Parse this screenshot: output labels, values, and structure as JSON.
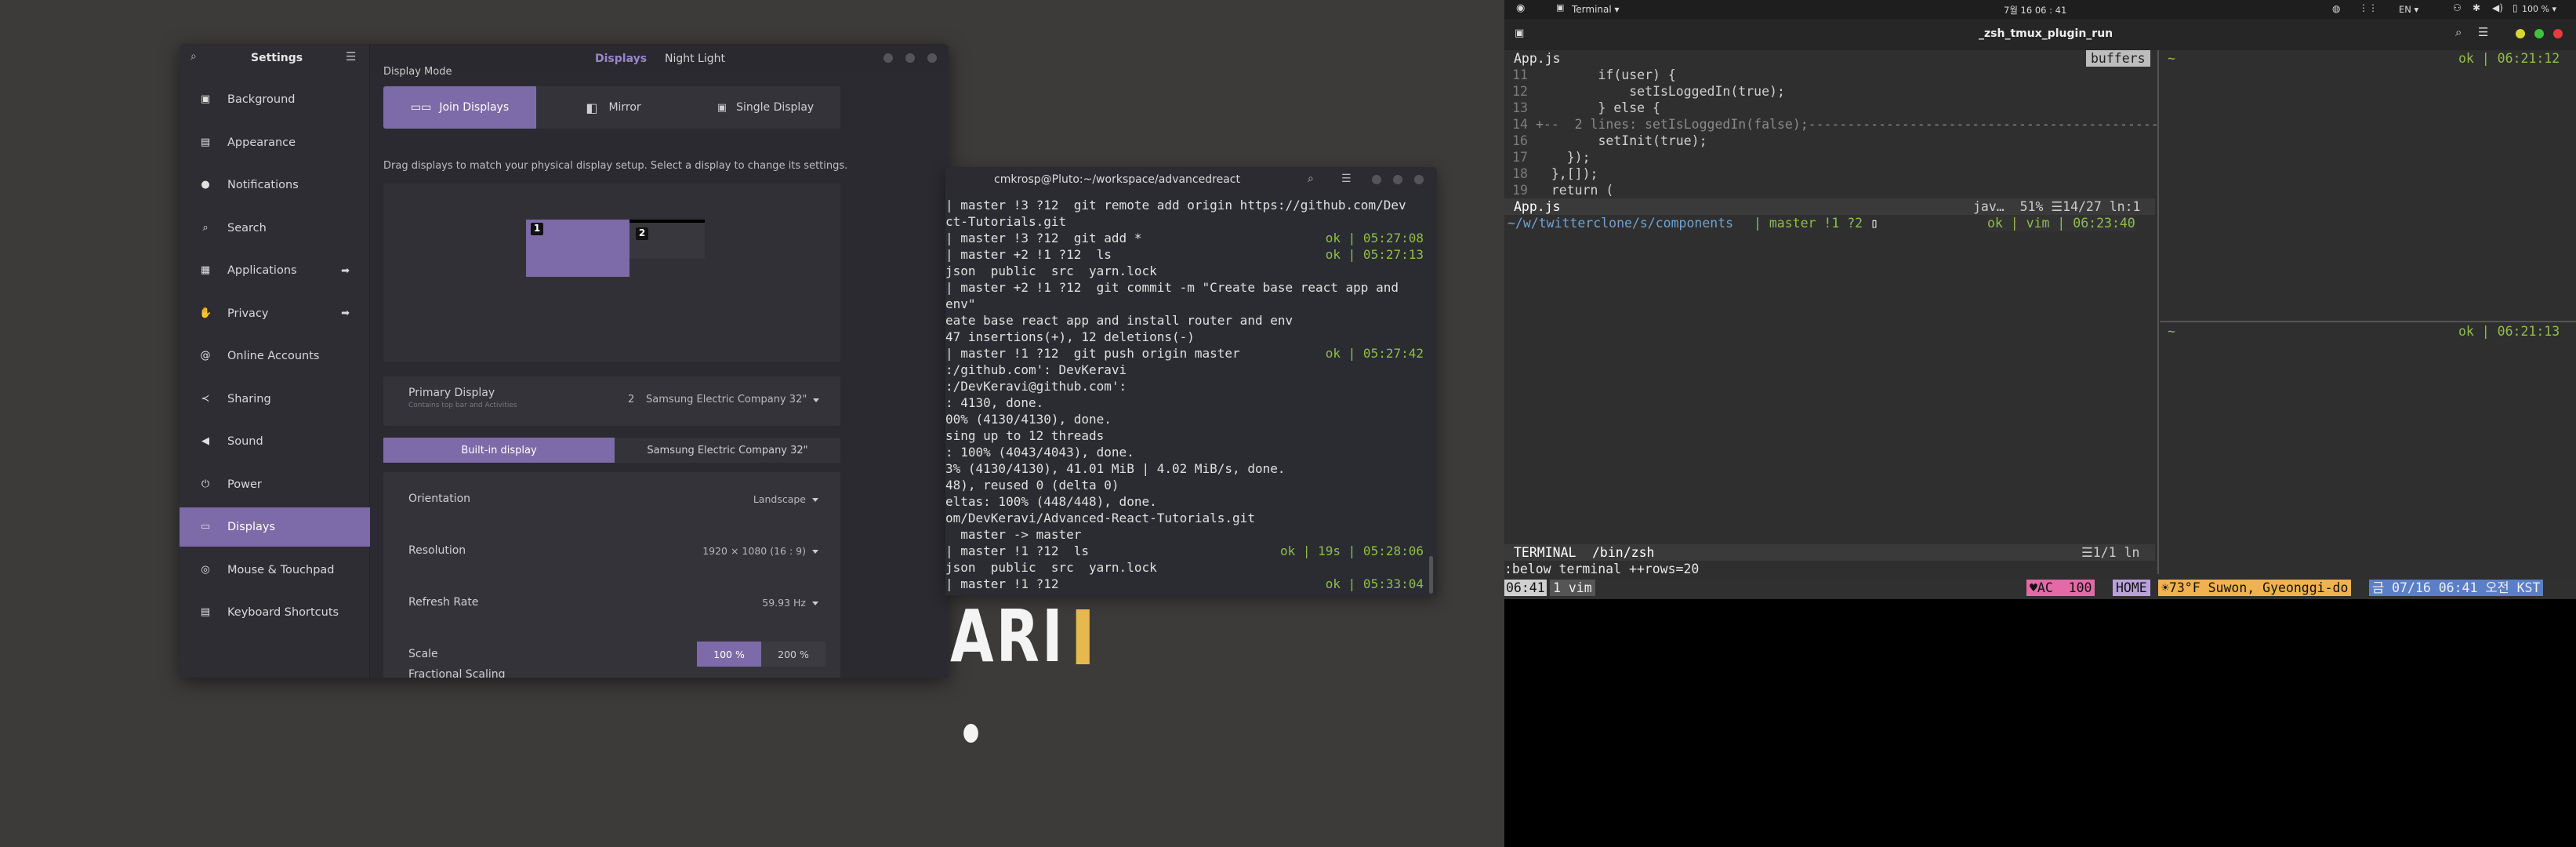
{
  "settings": {
    "search_icon": "search-icon",
    "title": "Settings",
    "tabs": [
      "Displays",
      "Night Light"
    ],
    "sidebar": [
      {
        "label": "Background",
        "icon": "image-icon",
        "arrow": false
      },
      {
        "label": "Appearance",
        "icon": "appearance-icon",
        "arrow": false
      },
      {
        "label": "Notifications",
        "icon": "bell-icon",
        "arrow": false
      },
      {
        "label": "Search",
        "icon": "search-icon",
        "arrow": false
      },
      {
        "label": "Applications",
        "icon": "grid-icon",
        "arrow": true
      },
      {
        "label": "Privacy",
        "icon": "hand-icon",
        "arrow": true
      },
      {
        "label": "Online Accounts",
        "icon": "at-icon",
        "arrow": false
      },
      {
        "label": "Sharing",
        "icon": "share-icon",
        "arrow": false
      },
      {
        "label": "Sound",
        "icon": "speaker-icon",
        "arrow": false
      },
      {
        "label": "Power",
        "icon": "power-icon",
        "arrow": false
      },
      {
        "label": "Displays",
        "icon": "monitor-icon",
        "arrow": false
      },
      {
        "label": "Mouse & Touchpad",
        "icon": "mouse-icon",
        "arrow": false
      },
      {
        "label": "Keyboard Shortcuts",
        "icon": "keyboard-icon",
        "arrow": false
      }
    ],
    "section_cut": "Display Mode",
    "modes": [
      "Join Displays",
      "Mirror",
      "Single Display"
    ],
    "hint": "Drag displays to match your physical display setup. Select a display to change its settings.",
    "monitor1": "1",
    "monitor2": "2",
    "primary_label": "Primary Display",
    "primary_sub": "Contains top bar and Activities",
    "primary_num": "2",
    "primary_value": "Samsung Electric Company 32\"",
    "display_tabs": [
      "Built-in display",
      "Samsung Electric Company 32\""
    ],
    "rows": [
      {
        "label": "Orientation",
        "value": "Landscape"
      },
      {
        "label": "Resolution",
        "value": "1920 × 1080 (16 : 9)"
      },
      {
        "label": "Refresh Rate",
        "value": "59.93 Hz"
      }
    ],
    "scale_label": "Scale",
    "scale_options": [
      "100 %",
      "200 %"
    ],
    "fractional": "Fractional Scaling"
  },
  "terminal": {
    "title": "cmkrosp@Pluto:~/workspace/advancedreact",
    "lines": [
      [
        "| master !3 ?12  git remote add origin https://github.com/Dev",
        ""
      ],
      [
        "ct-Tutorials.git",
        ""
      ],
      [
        "| master !3 ?12  git add *",
        "ok | 05:27:08"
      ],
      [
        "| master +2 !1 ?12  ls",
        "ok | 05:27:13"
      ],
      [
        "json  public  src  yarn.lock",
        ""
      ],
      [
        "| master +2 !1 ?12  git commit -m \"Create base react app and",
        ""
      ],
      [
        "env\"",
        ""
      ],
      [
        "eate base react app and install router and env",
        ""
      ],
      [
        "47 insertions(+), 12 deletions(-)",
        ""
      ],
      [
        "| master !1 ?12  git push origin master",
        "ok | 05:27:42"
      ],
      [
        ":/github.com': DevKeravi",
        ""
      ],
      [
        ":/DevKeravi@github.com':",
        ""
      ],
      [
        ": 4130, done.",
        ""
      ],
      [
        "00% (4130/4130), done.",
        ""
      ],
      [
        "sing up to 12 threads",
        ""
      ],
      [
        ": 100% (4043/4043), done.",
        ""
      ],
      [
        "3% (4130/4130), 41.01 MiB | 4.02 MiB/s, done.",
        ""
      ],
      [
        "48), reused 0 (delta 0)",
        ""
      ],
      [
        "eltas: 100% (448/448), done.",
        ""
      ],
      [
        "om/DevKeravi/Advanced-React-Tutorials.git",
        ""
      ],
      [
        "  master -> master",
        ""
      ],
      [
        "| master !1 ?12  ls",
        "ok | 19s | 05:28:06"
      ],
      [
        "json  public  src  yarn.lock",
        ""
      ],
      [
        "| master !1 ?12 ",
        "ok | 05:33:04"
      ]
    ]
  },
  "wallpaper_text": "ARI",
  "panel": {
    "app": "Terminal",
    "clock": "7월 16  06 : 41",
    "lang": "EN",
    "battery": "100 %"
  },
  "window_title": "_zsh_tmux_plugin_run",
  "vim": {
    "file": "App.js",
    "buffers": "buffers",
    "code": [
      [
        "11",
        "        if(user) {"
      ],
      [
        "12",
        "            setIsLoggedIn(true);"
      ],
      [
        "13",
        "        } else {"
      ],
      [
        "14",
        "+--  2 lines: setIsLoggedIn(false);-----------------------------------------------------"
      ],
      [
        "16",
        "        setInit(true);"
      ],
      [
        "17",
        "    });"
      ],
      [
        "18",
        "  },[]);"
      ],
      [
        "19",
        "  return ("
      ]
    ],
    "status_file": "App.js",
    "status_right": "jav…  51% ☰14/27 ln:1",
    "prompt_path": "~/w/twitterclone/s/components",
    "prompt_branch": "master !1 ?2",
    "prompt_right": "ok | vim | 06:23:40",
    "term_label": "TERMINAL",
    "term_shell": "/bin/zsh",
    "term_pos": "☰1/1 ln",
    "cmdline": ":below terminal ++rows=20"
  },
  "pane_top": {
    "tilde": "~",
    "status": "ok | 06:21:12"
  },
  "pane_bottom": {
    "tilde": "~",
    "status": "ok | 06:21:13"
  },
  "tmux": {
    "time": "06:41",
    "window": "1 vim",
    "ac": "♥AC  100",
    "home": "HOME",
    "weather": "☀73°F Suwon, Gyeonggi-do",
    "date": "금 07/16 06:41 오전 KST"
  }
}
